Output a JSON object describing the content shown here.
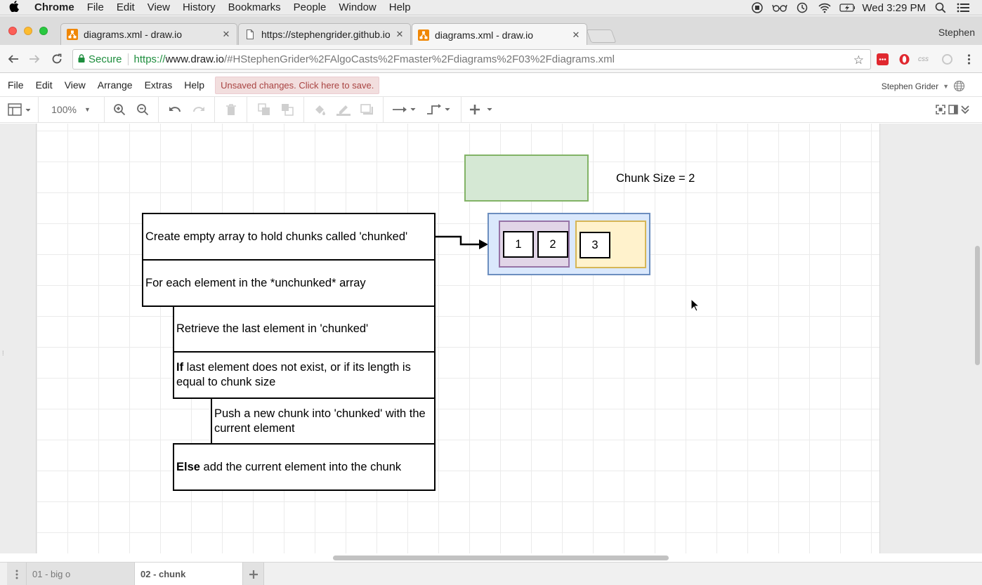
{
  "macos": {
    "app_name": "Chrome",
    "menus": [
      "File",
      "Edit",
      "View",
      "History",
      "Bookmarks",
      "People",
      "Window",
      "Help"
    ],
    "clock": "Wed 3:29 PM"
  },
  "browser": {
    "tabs": [
      {
        "title": "diagrams.xml - draw.io",
        "active": false
      },
      {
        "title": "https://stephengrider.github.io",
        "active": false
      },
      {
        "title": "diagrams.xml - draw.io",
        "active": true
      }
    ],
    "profile_name": "Stephen",
    "secure_label": "Secure",
    "url_scheme": "https://",
    "url_host": "www.draw.io",
    "url_path": "/#HStephenGrider%2FAlgoCasts%2Fmaster%2Fdiagrams%2F03%2Fdiagrams.xml"
  },
  "drawio": {
    "menus": [
      "File",
      "Edit",
      "View",
      "Arrange",
      "Extras",
      "Help"
    ],
    "unsaved_notice": "Unsaved changes. Click here to save.",
    "user_name": "Stephen Grider",
    "zoom": "100%"
  },
  "diagram": {
    "steps": [
      {
        "bold": "",
        "text": "Create empty array to hold chunks called 'chunked'"
      },
      {
        "bold": "",
        "text": "For each element in the *unchunked* array"
      },
      {
        "bold": "",
        "text": "Retrieve the last element in 'chunked'"
      },
      {
        "bold": "If",
        "text": " last element does not exist, or if its length is equal to chunk size"
      },
      {
        "bold": "",
        "text": "Push a new chunk into 'chunked' with the current element"
      },
      {
        "bold": "Else",
        "text": " add the current element into the chunk"
      }
    ],
    "chunk_size_label": "Chunk Size = 2",
    "chunk_values": [
      "1",
      "2",
      "3"
    ],
    "colors": {
      "green_fill": "#d5e8d4",
      "green_stroke": "#82b366",
      "blue_fill": "#dae8fc",
      "blue_stroke": "#6c8ebf",
      "purple_fill": "#e1d5e7",
      "purple_stroke": "#9673a6",
      "yellow_fill": "#fff2cc",
      "yellow_stroke": "#d6b656"
    }
  },
  "pages": [
    {
      "label": "01 - big o",
      "active": false
    },
    {
      "label": "02 - chunk",
      "active": true
    }
  ]
}
